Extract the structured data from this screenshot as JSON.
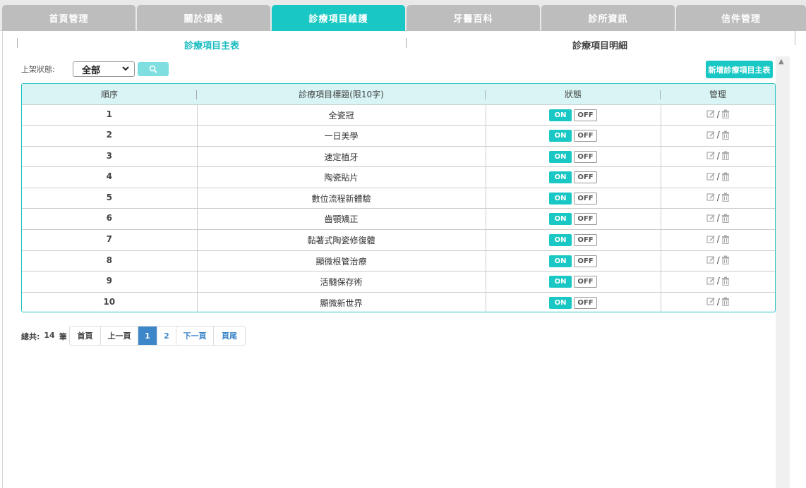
{
  "top_tabs": [
    {
      "label": "首頁管理",
      "active": false
    },
    {
      "label": "關於頌美",
      "active": false
    },
    {
      "label": "診療項目維護",
      "active": true
    },
    {
      "label": "牙醫百科",
      "active": false
    },
    {
      "label": "診所資訊",
      "active": false
    },
    {
      "label": "信件管理",
      "active": false
    }
  ],
  "sub_tabs": {
    "main": "診療項目主表",
    "detail": "診療項目明細"
  },
  "filter": {
    "label": "上架狀態:",
    "selected": "全部"
  },
  "add_button": "新增診療項目主表",
  "table": {
    "headers": [
      "順序",
      "診療項目標題(限10字)",
      "狀態",
      "管理"
    ],
    "rows": [
      {
        "order": "1",
        "title": "全瓷冠"
      },
      {
        "order": "2",
        "title": "一日美學"
      },
      {
        "order": "3",
        "title": "速定植牙"
      },
      {
        "order": "4",
        "title": "陶瓷貼片"
      },
      {
        "order": "5",
        "title": "數位流程新體驗"
      },
      {
        "order": "6",
        "title": "齒顎矯正"
      },
      {
        "order": "7",
        "title": "黏著式陶瓷修復體"
      },
      {
        "order": "8",
        "title": "顯微根管治療"
      },
      {
        "order": "9",
        "title": "活髓保存術"
      },
      {
        "order": "10",
        "title": "顯微新世界"
      }
    ],
    "on_label": "ON",
    "off_label": "OFF",
    "slash": "/"
  },
  "pagination": {
    "total_prefix": "總共:",
    "total_count": "14",
    "total_suffix": "筆",
    "first": "首頁",
    "prev": "上一頁",
    "pages": [
      "1",
      "2"
    ],
    "current": "1",
    "next": "下一頁",
    "last": "頁尾"
  },
  "colors": {
    "accent": "#19c8c4",
    "tab_inactive": "#bdbdbd",
    "header_bg": "#d8f4f4",
    "pager_active": "#3c86c9"
  }
}
